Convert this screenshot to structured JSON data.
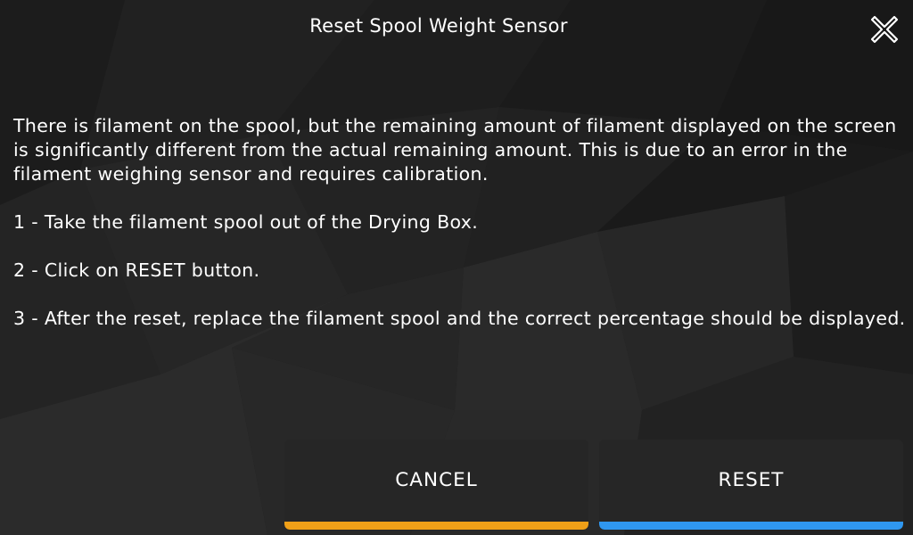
{
  "dialog": {
    "title": "Reset Spool Weight Sensor",
    "close_icon": "close-x-icon",
    "paragraphs": [
      "There is filament on the spool, but the remaining amount of filament displayed on the screen is significantly different from the actual remaining amount. This is due to an error in the filament weighing sensor and requires calibration.",
      "1 - Take the filament spool out of the Drying Box.",
      "2 - Click on RESET button.",
      "3 - After the reset, replace the filament spool and the correct percentage should be displayed."
    ]
  },
  "buttons": {
    "cancel_label": "CANCEL",
    "reset_label": "RESET"
  },
  "colors": {
    "cancel_accent": "#f0a018",
    "reset_accent": "#2f97f0",
    "background": "#202020",
    "button_bg": "#262626",
    "text": "#ffffff"
  }
}
